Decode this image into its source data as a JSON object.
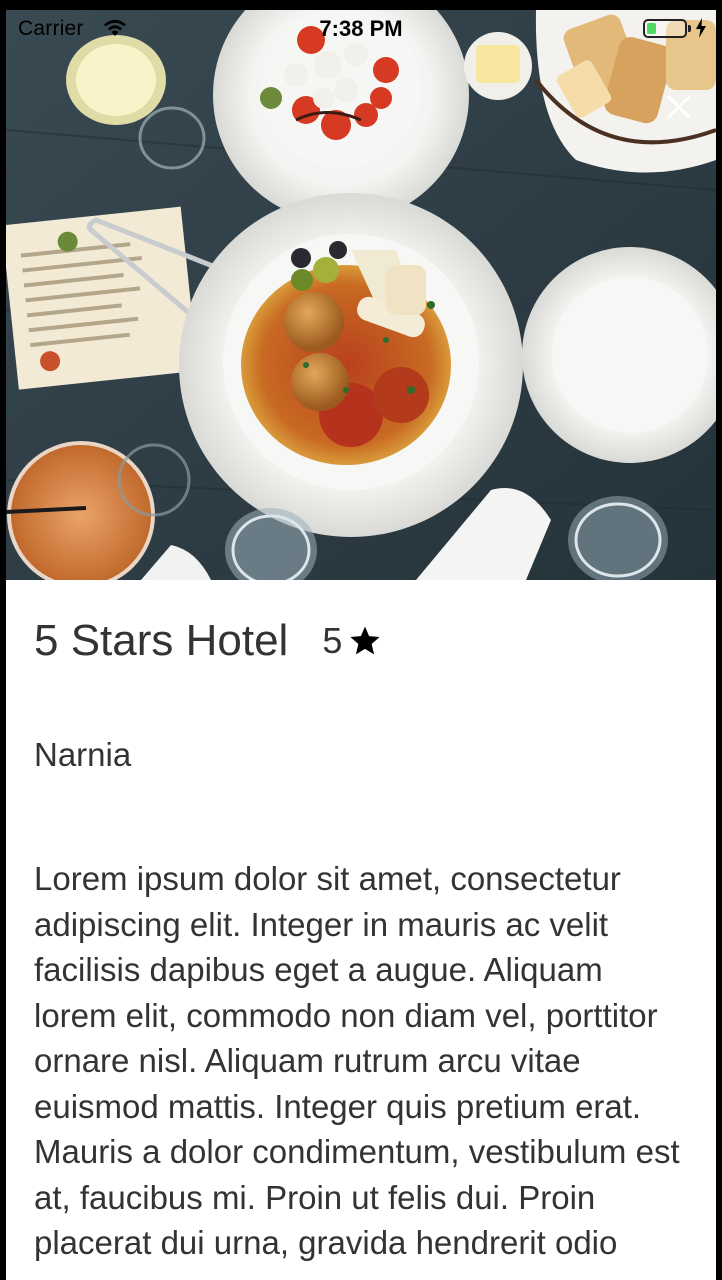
{
  "status_bar": {
    "carrier": "Carrier",
    "time": "7:38 PM",
    "battery_level": 0.25,
    "battery_color": "#4cd964",
    "wifi_icon": "wifi-icon",
    "charging_icon": "lightning-icon"
  },
  "hero": {
    "image_description_icon": "food-photo-image",
    "close_icon": "close-icon"
  },
  "hotel": {
    "name": "5 Stars Hotel",
    "rating": "5",
    "rating_icon": "star-icon",
    "location": "Narnia",
    "description": "Lorem ipsum dolor sit amet, consectetur adipiscing elit. Integer in mauris ac velit facilisis dapibus eget a augue. Aliquam lorem elit, commodo non diam vel, porttitor ornare nisl. Aliquam rutrum arcu vitae euismod mattis. Integer quis pretium erat. Mauris a dolor condimentum, vestibulum est at, faucibus mi. Proin ut felis dui. Proin placerat dui urna, gravida hendrerit odio"
  }
}
